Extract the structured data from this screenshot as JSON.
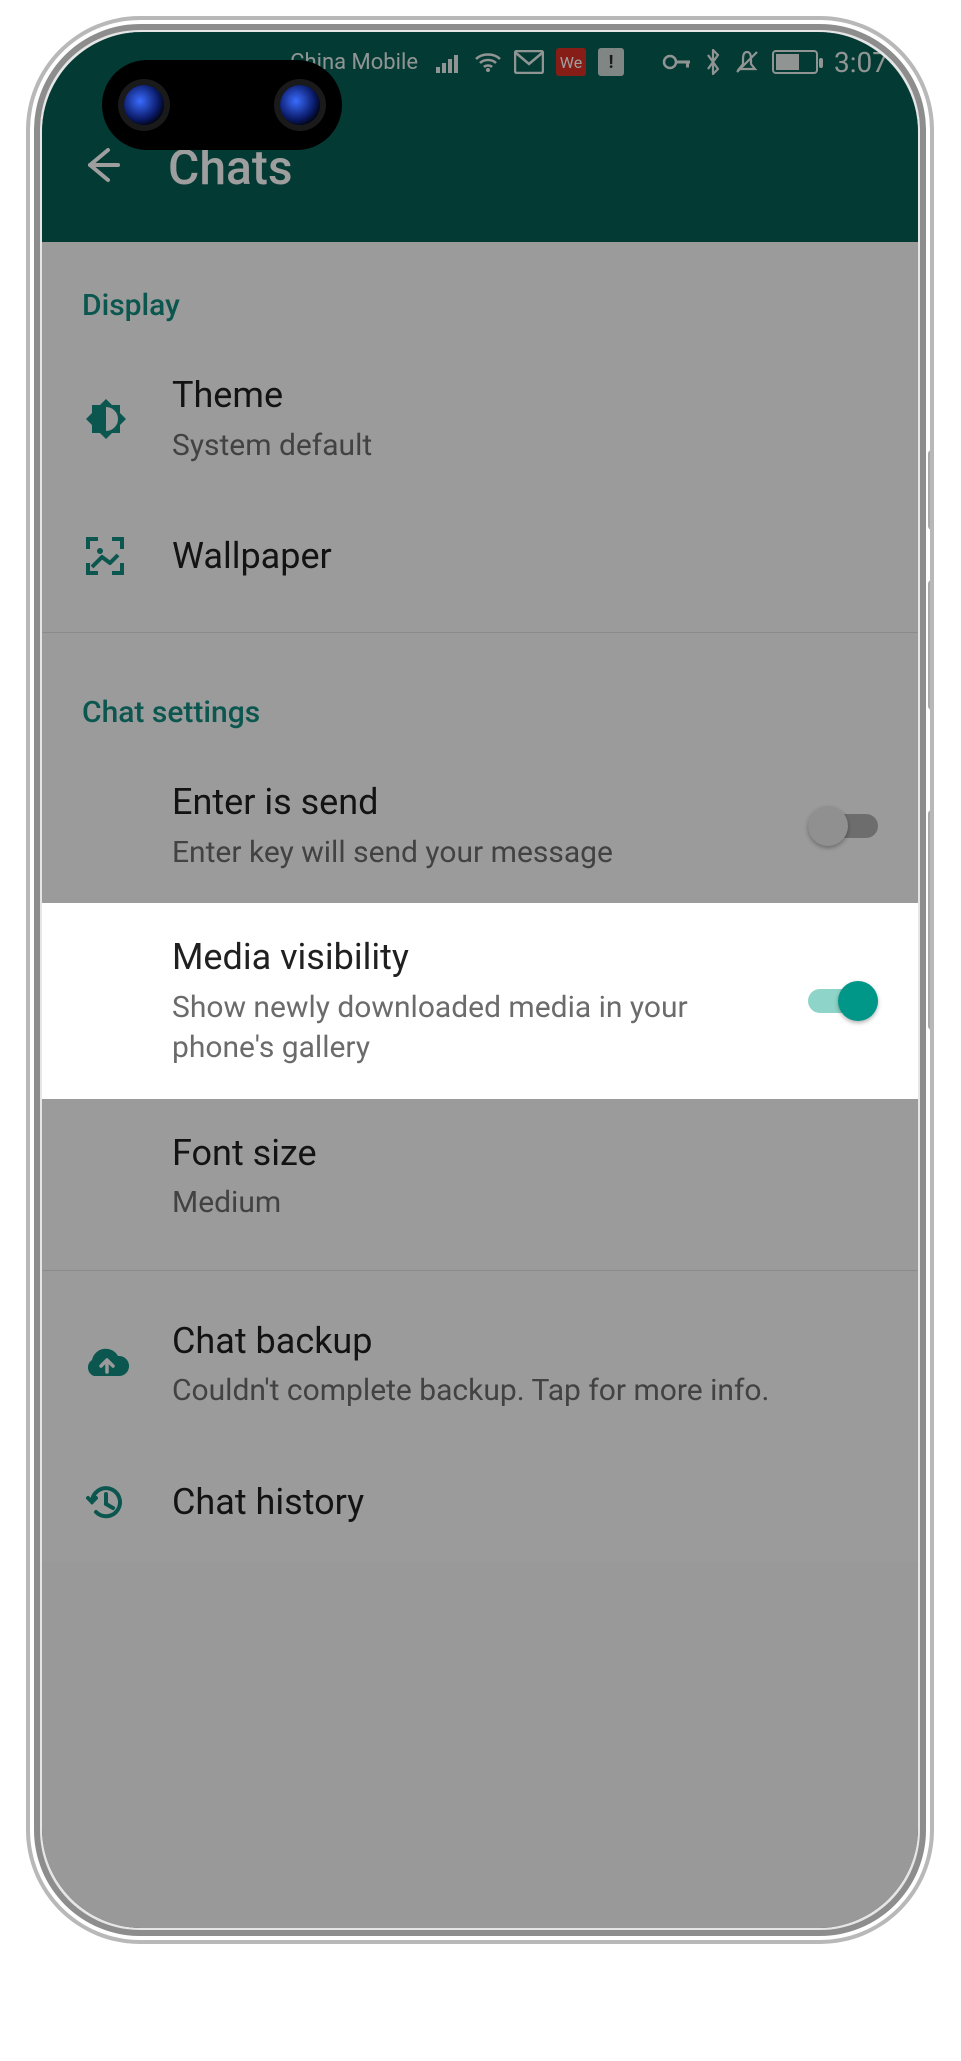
{
  "statusbar": {
    "carrier": "China Mobile",
    "time": "3:07",
    "badge_we": "We",
    "badge_alert": "!"
  },
  "appbar": {
    "title": "Chats"
  },
  "sections": {
    "display": {
      "header": "Display",
      "theme": {
        "title": "Theme",
        "sub": "System default"
      },
      "wallpaper": {
        "title": "Wallpaper"
      }
    },
    "chat": {
      "header": "Chat settings",
      "enter_is_send": {
        "title": "Enter is send",
        "sub": "Enter key will send your message",
        "on": false
      },
      "media_visibility": {
        "title": "Media visibility",
        "sub": "Show newly downloaded media in your phone's gallery",
        "on": true
      },
      "font_size": {
        "title": "Font size",
        "sub": "Medium"
      },
      "chat_backup": {
        "title": "Chat backup",
        "sub": "Couldn't complete backup. Tap for more info."
      },
      "chat_history": {
        "title": "Chat history"
      }
    }
  }
}
